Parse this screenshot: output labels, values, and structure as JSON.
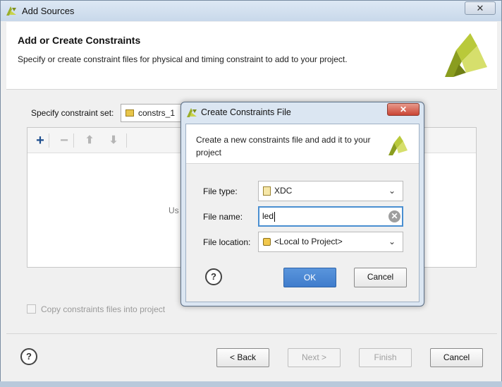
{
  "window": {
    "title": "Add Sources",
    "close_glyph": "✕"
  },
  "header": {
    "title": "Add or Create Constraints",
    "description": "Specify or create constraint files for physical and timing constraint to add to your project."
  },
  "constraint_set": {
    "label": "Specify constraint set:",
    "value": "constrs_1"
  },
  "toolbar": {
    "add_icon": "+",
    "remove_icon": "−",
    "up_icon": "⬆",
    "down_icon": "⬇"
  },
  "list": {
    "hint": "Us"
  },
  "copy_option": {
    "label": "Copy constraints files into project",
    "checked": false
  },
  "footer": {
    "help_label": "?",
    "back_label": "< Back",
    "next_label": "Next >",
    "finish_label": "Finish",
    "cancel_label": "Cancel"
  },
  "dialog": {
    "title": "Create Constraints File",
    "close_glyph": "✕",
    "description": "Create a new constraints file and add it to your project",
    "file_type_label": "File type:",
    "file_type_value": "XDC",
    "file_name_label": "File name:",
    "file_name_value": "led",
    "file_location_label": "File location:",
    "file_location_value": "<Local to Project>",
    "clear_glyph": "✕",
    "help_label": "?",
    "ok_label": "OK",
    "cancel_label": "Cancel",
    "chevron_glyph": "⌄"
  },
  "colors": {
    "accent": "#4a8fd1",
    "ok_button": "#3f7ccc",
    "logo_green": "#9aae2a",
    "close_red": "#c94535"
  }
}
